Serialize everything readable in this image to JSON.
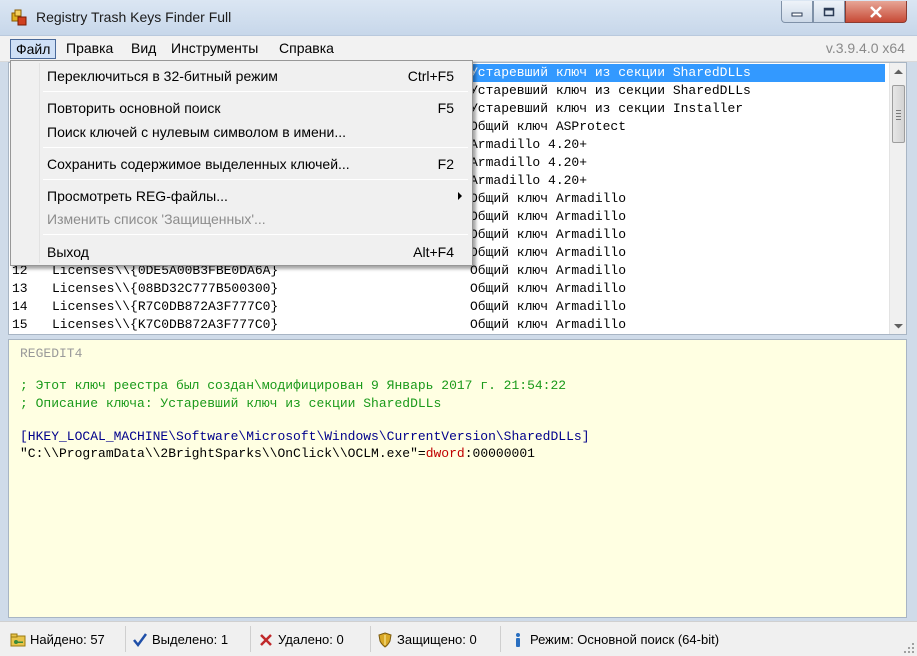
{
  "window": {
    "title": "Registry Trash Keys Finder Full",
    "version": "v.3.9.4.0 x64"
  },
  "menubar": [
    "Файл",
    "Правка",
    "Вид",
    "Инструменты",
    "Справка"
  ],
  "file_menu": {
    "items": [
      {
        "label": "Переключиться в 32-битный режим",
        "shortcut": "Ctrl+F5"
      },
      {
        "label": "Повторить основной поиск",
        "shortcut": "F5"
      },
      {
        "label": "Поиск ключей с нулевым символом в имени...",
        "shortcut": ""
      },
      {
        "label": "Сохранить содержимое выделенных ключей...",
        "shortcut": "F2"
      },
      {
        "label": "Просмотреть REG-файлы...",
        "shortcut": ""
      },
      {
        "label": "Изменить список 'Защищенных'...",
        "shortcut": ""
      },
      {
        "label": "Выход",
        "shortcut": "Alt+F4"
      }
    ]
  },
  "list": {
    "rows": [
      {
        "num": "",
        "key": "",
        "type": "Устаревший ключ из секции SharedDLLs",
        "selected": true
      },
      {
        "num": "",
        "key": "",
        "type": "Устаревший ключ из секции SharedDLLs"
      },
      {
        "num": "",
        "key": "",
        "type": "Устаревший ключ из секции Installer"
      },
      {
        "num": "",
        "key": "",
        "type": "Общий ключ ASProtect"
      },
      {
        "num": "",
        "key": "",
        "type": "Armadillo 4.20+"
      },
      {
        "num": "",
        "key": "",
        "type": "Armadillo 4.20+"
      },
      {
        "num": "",
        "key": "",
        "type": "Armadillo 4.20+"
      },
      {
        "num": "",
        "key": "",
        "type": "Общий ключ Armadillo"
      },
      {
        "num": "",
        "key": "",
        "type": "Общий ключ Armadillo"
      },
      {
        "num": "",
        "key": "",
        "type": "Общий ключ Armadillo"
      },
      {
        "num": "",
        "key": "",
        "type": "Общий ключ Armadillo"
      },
      {
        "num": "12",
        "key": "Licenses\\\\{0DE5A00B3FBE0DA6A}",
        "type": "Общий ключ Armadillo"
      },
      {
        "num": "13",
        "key": "Licenses\\\\{08BD32C777B500300}",
        "type": "Общий ключ Armadillo"
      },
      {
        "num": "14",
        "key": "Licenses\\\\{R7C0DB872A3F777C0}",
        "type": "Общий ключ Armadillo"
      },
      {
        "num": "15",
        "key": "Licenses\\\\{K7C0DB872A3F777C0}",
        "type": "Общий ключ Armadillo"
      }
    ]
  },
  "reg": {
    "header": "REGEDIT4",
    "comment1": "; Этот ключ реестра был создан\\модифицирован 9 Январь 2017 г. 21:54:22",
    "comment2": "; Описание ключа: Устаревший ключ из секции SharedDLLs",
    "key_path": "[HKEY_LOCAL_MACHINE\\Software\\Microsoft\\Windows\\CurrentVersion\\SharedDLLs]",
    "value_name": "\"C:\\\\ProgramData\\\\2BrightSparks\\\\OnClick\\\\OCLM.exe\"",
    "eq": "=",
    "value_type": "dword",
    "colon": ":",
    "value_data": "00000001"
  },
  "status": {
    "found": "Найдено: 57",
    "selected": "Выделено: 1",
    "deleted": "Удалено: 0",
    "protected": "Защищено: 0",
    "mode": "Режим: Основной поиск (64-bit)"
  }
}
